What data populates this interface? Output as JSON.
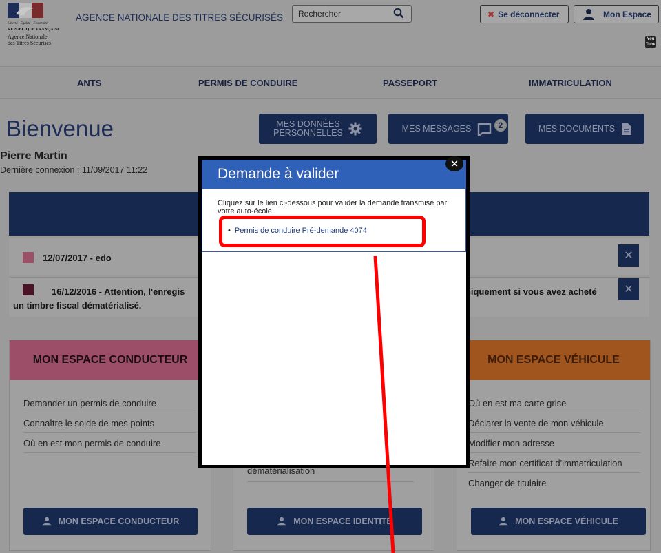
{
  "header": {
    "logo": {
      "motto": "Liberté • Égalité • Fraternité",
      "republic": "RÉPUBLIQUE FRANÇAISE",
      "agency_line1": "Agence Nationale",
      "agency_line2": "des Titres Sécurisés"
    },
    "title": "AGENCE NATIONALE DES TITRES SÉCURISÉS",
    "search": {
      "placeholder": "Rechercher",
      "icon": "search-icon"
    },
    "logout_label": "Se déconnecter",
    "my_space_label": "Mon Espace",
    "youtube_line1": "You",
    "youtube_line2": "Tube"
  },
  "nav": {
    "items": [
      {
        "label": "ANTS"
      },
      {
        "label": "PERMIS DE CONDUIRE"
      },
      {
        "label": "PASSEPORT"
      },
      {
        "label": "IMMATRICULATION"
      }
    ]
  },
  "welcome": {
    "title": "Bienvenue",
    "user": "Pierre Martin",
    "last_login": "Dernière connexion : 11/09/2017 11:22"
  },
  "top_buttons": {
    "donnees_line1": "MES DONNÉES",
    "donnees_line2": "PERSONNELLES",
    "messages": "MES MESSAGES",
    "messages_count": "2",
    "documents": "MES DOCUMENTS"
  },
  "notices": {
    "first": "12/07/2017 - edo",
    "second_start": "16/12/2016 - Attention, l'enregis",
    "second_end": "uniquement si vous avez acheté",
    "second_line2": "un timbre fiscal dématérialisé."
  },
  "spaces": {
    "conducteur": {
      "title": "MON ESPACE CONDUCTEUR",
      "items": [
        "Demander un permis de conduire",
        "Connaître le solde de mes points",
        "Où en est mon permis de conduire"
      ],
      "button": "MON ESPACE CONDUCTEUR"
    },
    "identite": {
      "partial_item": "dématérialisation",
      "button": "MON ESPACE IDENTITÉ"
    },
    "vehicule": {
      "title": "MON ESPACE VÉHICULE",
      "items": [
        "Où en est ma carte grise",
        "Déclarer la vente de mon véhicule",
        "Modifier mon adresse",
        "Refaire mon certificat d'immatriculation",
        "Changer de titulaire"
      ],
      "button": "MON ESPACE VÉHICULE"
    }
  },
  "modal": {
    "title": "Demande à valider",
    "intro": "Cliquez sur le lien ci-dessous pour valider la demande transmise par votre auto-école",
    "link": "Permis de conduire Pré-demande 4074",
    "close": "✕"
  },
  "colors": {
    "navy": "#17284f",
    "modal_blue": "#2f61b8",
    "annotation_red": "#ff0000"
  }
}
